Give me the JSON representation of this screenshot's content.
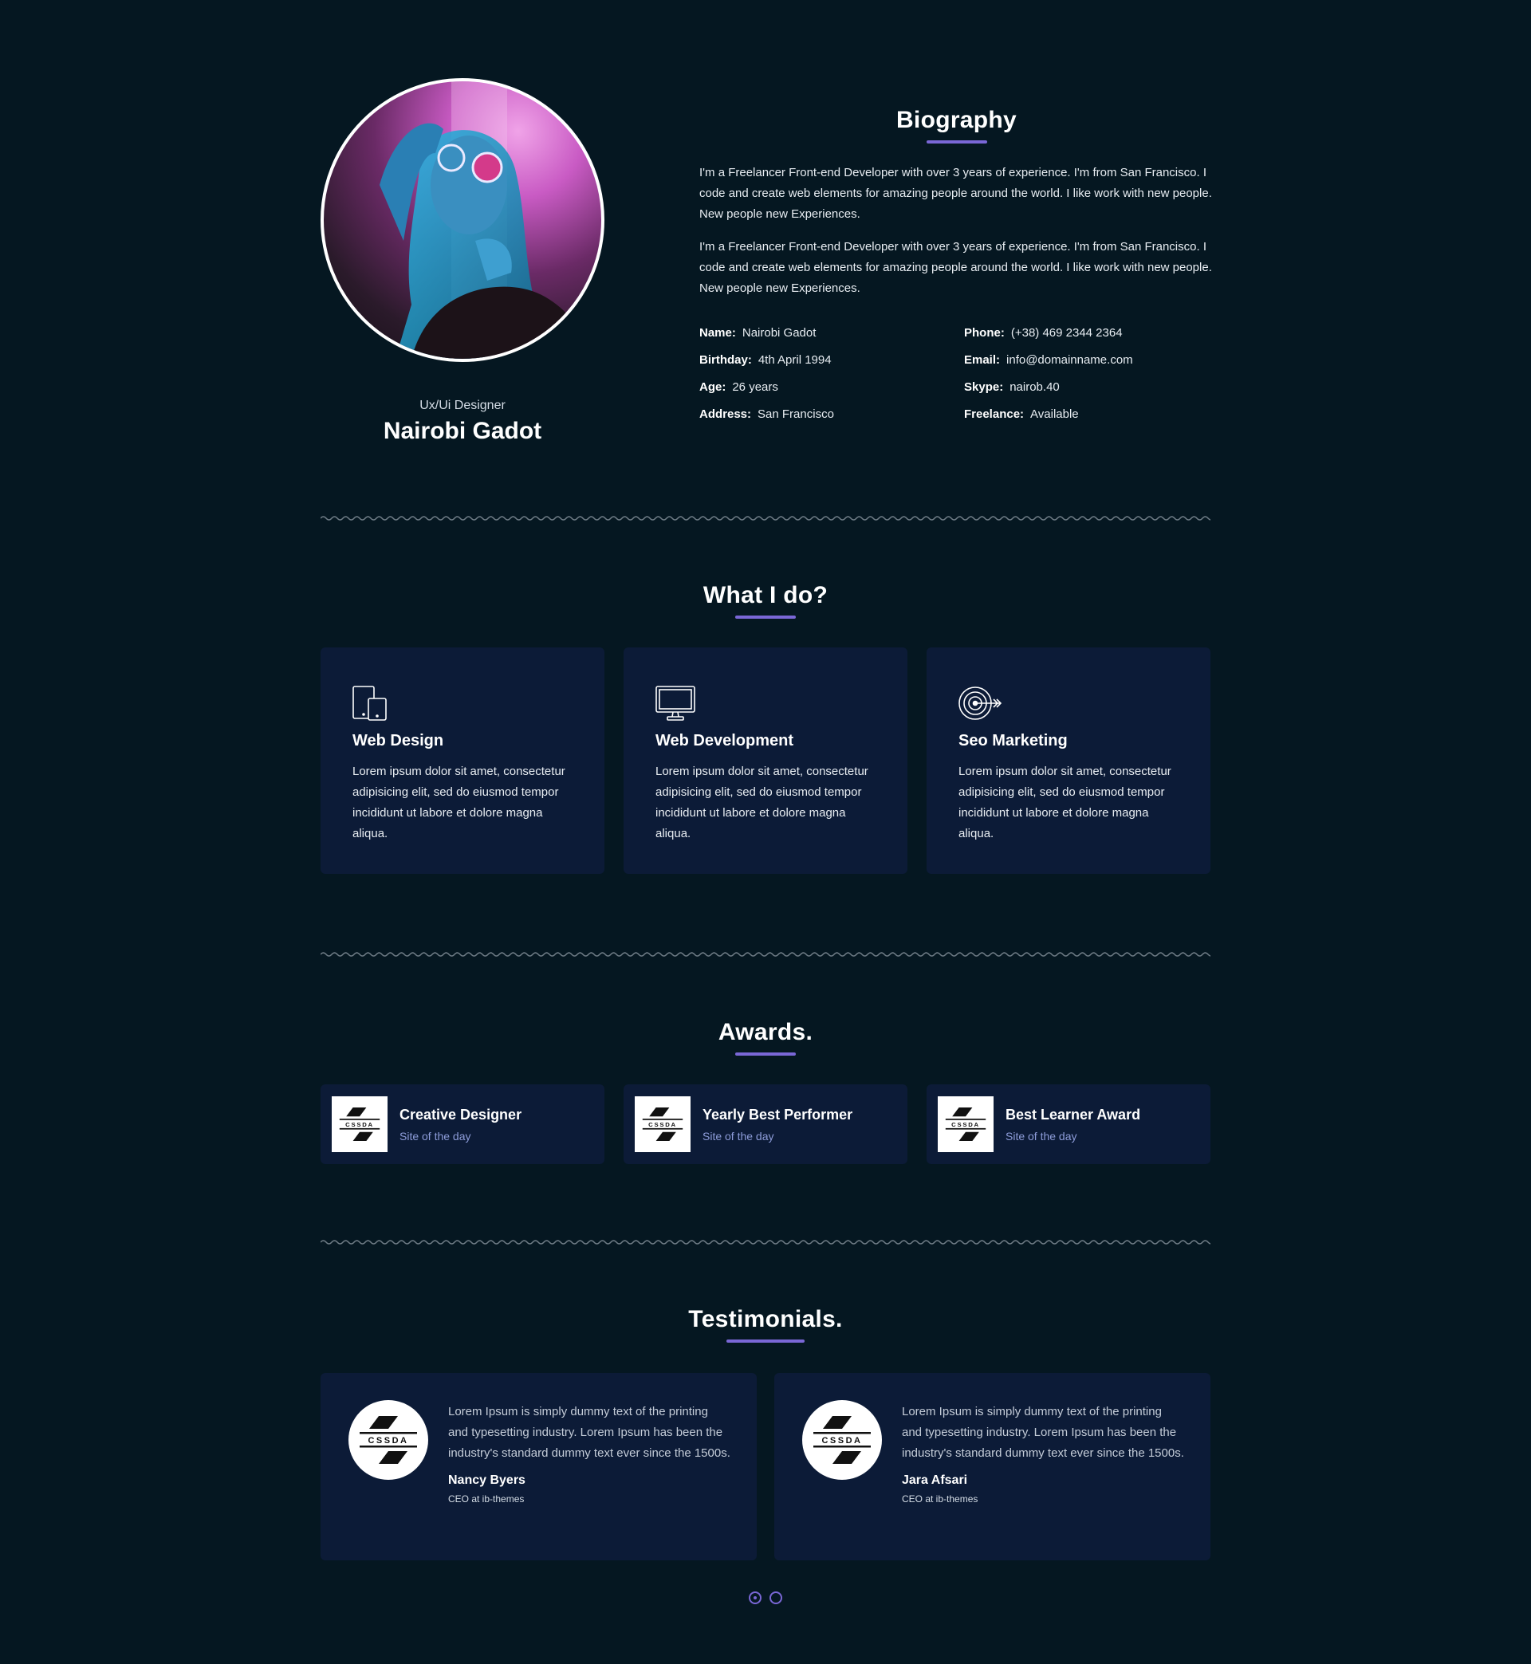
{
  "profile": {
    "role": "Ux/Ui Designer",
    "name": "Nairobi Gadot"
  },
  "biography": {
    "title": "Biography",
    "paragraphs": [
      "I'm a Freelancer Front-end Developer with over 3 years of experience. I'm from San Francisco. I code and create web elements for amazing people around the world. I like work with new people. New people new Experiences.",
      "I'm a Freelancer Front-end Developer with over 3 years of experience. I'm from San Francisco. I code and create web elements for amazing people around the world. I like work with new people. New people new Experiences."
    ],
    "info_left": [
      {
        "label": "Name:",
        "value": "Nairobi Gadot"
      },
      {
        "label": "Birthday:",
        "value": "4th April 1994"
      },
      {
        "label": "Age:",
        "value": "26 years"
      },
      {
        "label": "Address:",
        "value": "San Francisco"
      }
    ],
    "info_right": [
      {
        "label": "Phone:",
        "value": "(+38) 469 2344 2364"
      },
      {
        "label": "Email:",
        "value": "info@domainname.com"
      },
      {
        "label": "Skype:",
        "value": "nairob.40"
      },
      {
        "label": "Freelance:",
        "value": "Available"
      }
    ]
  },
  "services": {
    "title": "What I do?",
    "items": [
      {
        "icon": "devices-icon",
        "title": "Web Design",
        "description": "Lorem ipsum dolor sit amet, consectetur adipisicing elit, sed do eiusmod tempor incididunt ut labore et dolore magna aliqua."
      },
      {
        "icon": "monitor-icon",
        "title": "Web Development",
        "description": "Lorem ipsum dolor sit amet, consectetur adipisicing elit, sed do eiusmod tempor incididunt ut labore et dolore magna aliqua."
      },
      {
        "icon": "target-icon",
        "title": "Seo Marketing",
        "description": "Lorem ipsum dolor sit amet, consectetur adipisicing elit, sed do eiusmod tempor incididunt ut labore et dolore magna aliqua."
      }
    ]
  },
  "awards": {
    "title": "Awards.",
    "logo_text": "CSSDA",
    "items": [
      {
        "title": "Creative Designer",
        "subtitle": "Site of the day"
      },
      {
        "title": "Yearly Best Performer",
        "subtitle": "Site of the day"
      },
      {
        "title": "Best Learner Award",
        "subtitle": "Site of the day"
      }
    ]
  },
  "testimonials": {
    "title": "Testimonials.",
    "items": [
      {
        "quote": "Lorem Ipsum is simply dummy text of the printing and typesetting industry. Lorem Ipsum has been the industry's standard dummy text ever since the 1500s.",
        "name": "Nancy Byers",
        "role": "CEO at ib-themes"
      },
      {
        "quote": "Lorem Ipsum is simply dummy text of the printing and typesetting industry. Lorem Ipsum has been the industry's standard dummy text ever since the 1500s.",
        "name": "Jara Afsari",
        "role": "CEO at ib-themes"
      }
    ],
    "active_slide": 1
  },
  "colors": {
    "background": "#051721",
    "card": "#0c1b37",
    "accent": "#7a67d6",
    "subtitle": "#8d9cd9"
  }
}
